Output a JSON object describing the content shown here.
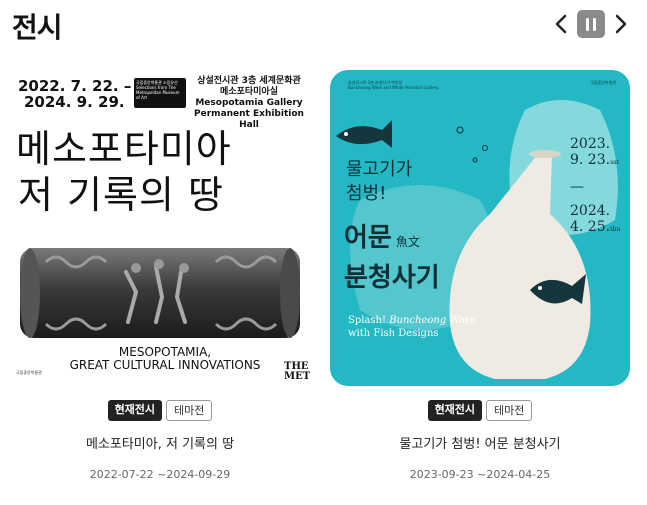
{
  "header": {
    "title": "전시"
  },
  "nav": {
    "prev_icon": "chevron-left-icon",
    "pause_icon": "pause-icon",
    "next_icon": "chevron-right-icon",
    "pause_color": "#8a8a8a"
  },
  "exhibitions": [
    {
      "poster": {
        "date_line1": "2022. 7. 22. –",
        "date_line2": "2024. 9. 29.",
        "logo_text": "국립중앙박물관 소장유산 Selections from The Metropolitan Museum of Art",
        "hall_ko_line1": "상설전시관 3층 세계문화관",
        "hall_ko_line2": "메소포타미아실",
        "hall_en_line1": "Mesopotamia Gallery",
        "hall_en_line2": "Permanent Exhibition Hall",
        "big_title_line1": "메소포타미아",
        "big_title_line2": "저 기록의 땅",
        "en_title_line1": "MESOPOTAMIA,",
        "en_title_line2": "GREAT CULTURAL INNOVATIONS",
        "museum_small": "국립중앙박물관",
        "met_logo": "THE MET"
      },
      "badges": [
        "현재전시",
        "테마전"
      ],
      "title": "메소포타미아, 저 기록의 땅",
      "date": "2022-07-22 ~2024-09-29"
    },
    {
      "poster": {
        "venue_small": "상설전시관 3층 분청사기·백자실",
        "venue_small_en": "Buncheong Ware and White Porcelain Gallery",
        "museum_small": "국립중앙박물관",
        "title_line1": "물고기가",
        "title_line2": "첨벙!",
        "title_line3": "어문",
        "hanja": "魚文",
        "title_line4": "분청사기",
        "en_line1_a": "Splash! ",
        "en_line1_b": "Buncheong",
        "en_line1_c": " Ware",
        "en_line2": "with Fish Designs",
        "date_start": "2023.",
        "date_start2": "9. 23.",
        "date_start_day": "sat",
        "date_dash": "—",
        "date_end": "2024.",
        "date_end2": "4. 25.",
        "date_end_day": "thu",
        "background": "#24b7c4"
      },
      "badges": [
        "현재전시",
        "테마전"
      ],
      "title": "물고기가 첨벙! 어문 분청사기",
      "date": "2023-09-23 ~2024-04-25"
    }
  ]
}
